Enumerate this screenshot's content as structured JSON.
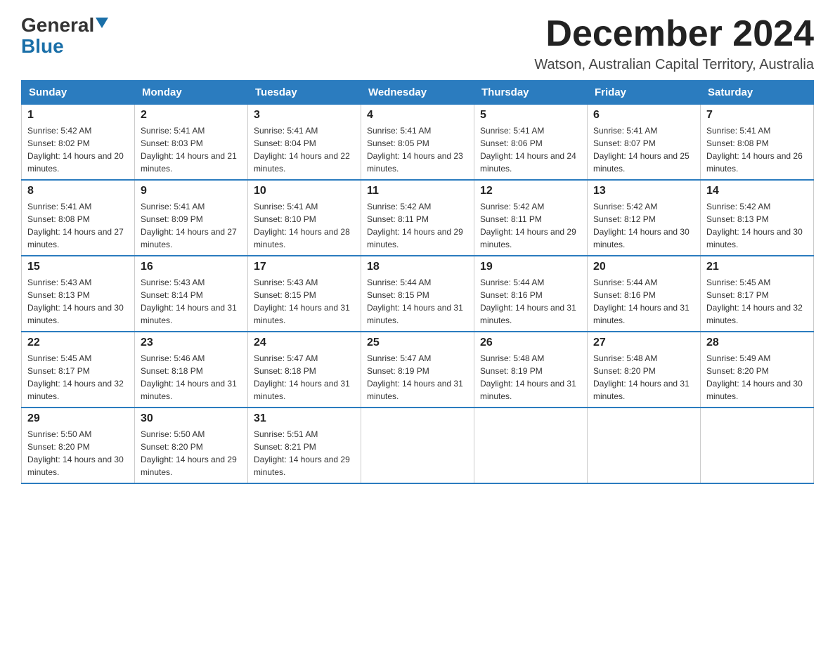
{
  "header": {
    "logo_line1": "General",
    "logo_line2": "Blue",
    "month_title": "December 2024",
    "location": "Watson, Australian Capital Territory, Australia"
  },
  "days_of_week": [
    "Sunday",
    "Monday",
    "Tuesday",
    "Wednesday",
    "Thursday",
    "Friday",
    "Saturday"
  ],
  "weeks": [
    [
      {
        "day": "1",
        "sunrise": "5:42 AM",
        "sunset": "8:02 PM",
        "daylight": "14 hours and 20 minutes."
      },
      {
        "day": "2",
        "sunrise": "5:41 AM",
        "sunset": "8:03 PM",
        "daylight": "14 hours and 21 minutes."
      },
      {
        "day": "3",
        "sunrise": "5:41 AM",
        "sunset": "8:04 PM",
        "daylight": "14 hours and 22 minutes."
      },
      {
        "day": "4",
        "sunrise": "5:41 AM",
        "sunset": "8:05 PM",
        "daylight": "14 hours and 23 minutes."
      },
      {
        "day": "5",
        "sunrise": "5:41 AM",
        "sunset": "8:06 PM",
        "daylight": "14 hours and 24 minutes."
      },
      {
        "day": "6",
        "sunrise": "5:41 AM",
        "sunset": "8:07 PM",
        "daylight": "14 hours and 25 minutes."
      },
      {
        "day": "7",
        "sunrise": "5:41 AM",
        "sunset": "8:08 PM",
        "daylight": "14 hours and 26 minutes."
      }
    ],
    [
      {
        "day": "8",
        "sunrise": "5:41 AM",
        "sunset": "8:08 PM",
        "daylight": "14 hours and 27 minutes."
      },
      {
        "day": "9",
        "sunrise": "5:41 AM",
        "sunset": "8:09 PM",
        "daylight": "14 hours and 27 minutes."
      },
      {
        "day": "10",
        "sunrise": "5:41 AM",
        "sunset": "8:10 PM",
        "daylight": "14 hours and 28 minutes."
      },
      {
        "day": "11",
        "sunrise": "5:42 AM",
        "sunset": "8:11 PM",
        "daylight": "14 hours and 29 minutes."
      },
      {
        "day": "12",
        "sunrise": "5:42 AM",
        "sunset": "8:11 PM",
        "daylight": "14 hours and 29 minutes."
      },
      {
        "day": "13",
        "sunrise": "5:42 AM",
        "sunset": "8:12 PM",
        "daylight": "14 hours and 30 minutes."
      },
      {
        "day": "14",
        "sunrise": "5:42 AM",
        "sunset": "8:13 PM",
        "daylight": "14 hours and 30 minutes."
      }
    ],
    [
      {
        "day": "15",
        "sunrise": "5:43 AM",
        "sunset": "8:13 PM",
        "daylight": "14 hours and 30 minutes."
      },
      {
        "day": "16",
        "sunrise": "5:43 AM",
        "sunset": "8:14 PM",
        "daylight": "14 hours and 31 minutes."
      },
      {
        "day": "17",
        "sunrise": "5:43 AM",
        "sunset": "8:15 PM",
        "daylight": "14 hours and 31 minutes."
      },
      {
        "day": "18",
        "sunrise": "5:44 AM",
        "sunset": "8:15 PM",
        "daylight": "14 hours and 31 minutes."
      },
      {
        "day": "19",
        "sunrise": "5:44 AM",
        "sunset": "8:16 PM",
        "daylight": "14 hours and 31 minutes."
      },
      {
        "day": "20",
        "sunrise": "5:44 AM",
        "sunset": "8:16 PM",
        "daylight": "14 hours and 31 minutes."
      },
      {
        "day": "21",
        "sunrise": "5:45 AM",
        "sunset": "8:17 PM",
        "daylight": "14 hours and 32 minutes."
      }
    ],
    [
      {
        "day": "22",
        "sunrise": "5:45 AM",
        "sunset": "8:17 PM",
        "daylight": "14 hours and 32 minutes."
      },
      {
        "day": "23",
        "sunrise": "5:46 AM",
        "sunset": "8:18 PM",
        "daylight": "14 hours and 31 minutes."
      },
      {
        "day": "24",
        "sunrise": "5:47 AM",
        "sunset": "8:18 PM",
        "daylight": "14 hours and 31 minutes."
      },
      {
        "day": "25",
        "sunrise": "5:47 AM",
        "sunset": "8:19 PM",
        "daylight": "14 hours and 31 minutes."
      },
      {
        "day": "26",
        "sunrise": "5:48 AM",
        "sunset": "8:19 PM",
        "daylight": "14 hours and 31 minutes."
      },
      {
        "day": "27",
        "sunrise": "5:48 AM",
        "sunset": "8:20 PM",
        "daylight": "14 hours and 31 minutes."
      },
      {
        "day": "28",
        "sunrise": "5:49 AM",
        "sunset": "8:20 PM",
        "daylight": "14 hours and 30 minutes."
      }
    ],
    [
      {
        "day": "29",
        "sunrise": "5:50 AM",
        "sunset": "8:20 PM",
        "daylight": "14 hours and 30 minutes."
      },
      {
        "day": "30",
        "sunrise": "5:50 AM",
        "sunset": "8:20 PM",
        "daylight": "14 hours and 29 minutes."
      },
      {
        "day": "31",
        "sunrise": "5:51 AM",
        "sunset": "8:21 PM",
        "daylight": "14 hours and 29 minutes."
      },
      null,
      null,
      null,
      null
    ]
  ],
  "labels": {
    "sunrise": "Sunrise: ",
    "sunset": "Sunset: ",
    "daylight": "Daylight: "
  }
}
